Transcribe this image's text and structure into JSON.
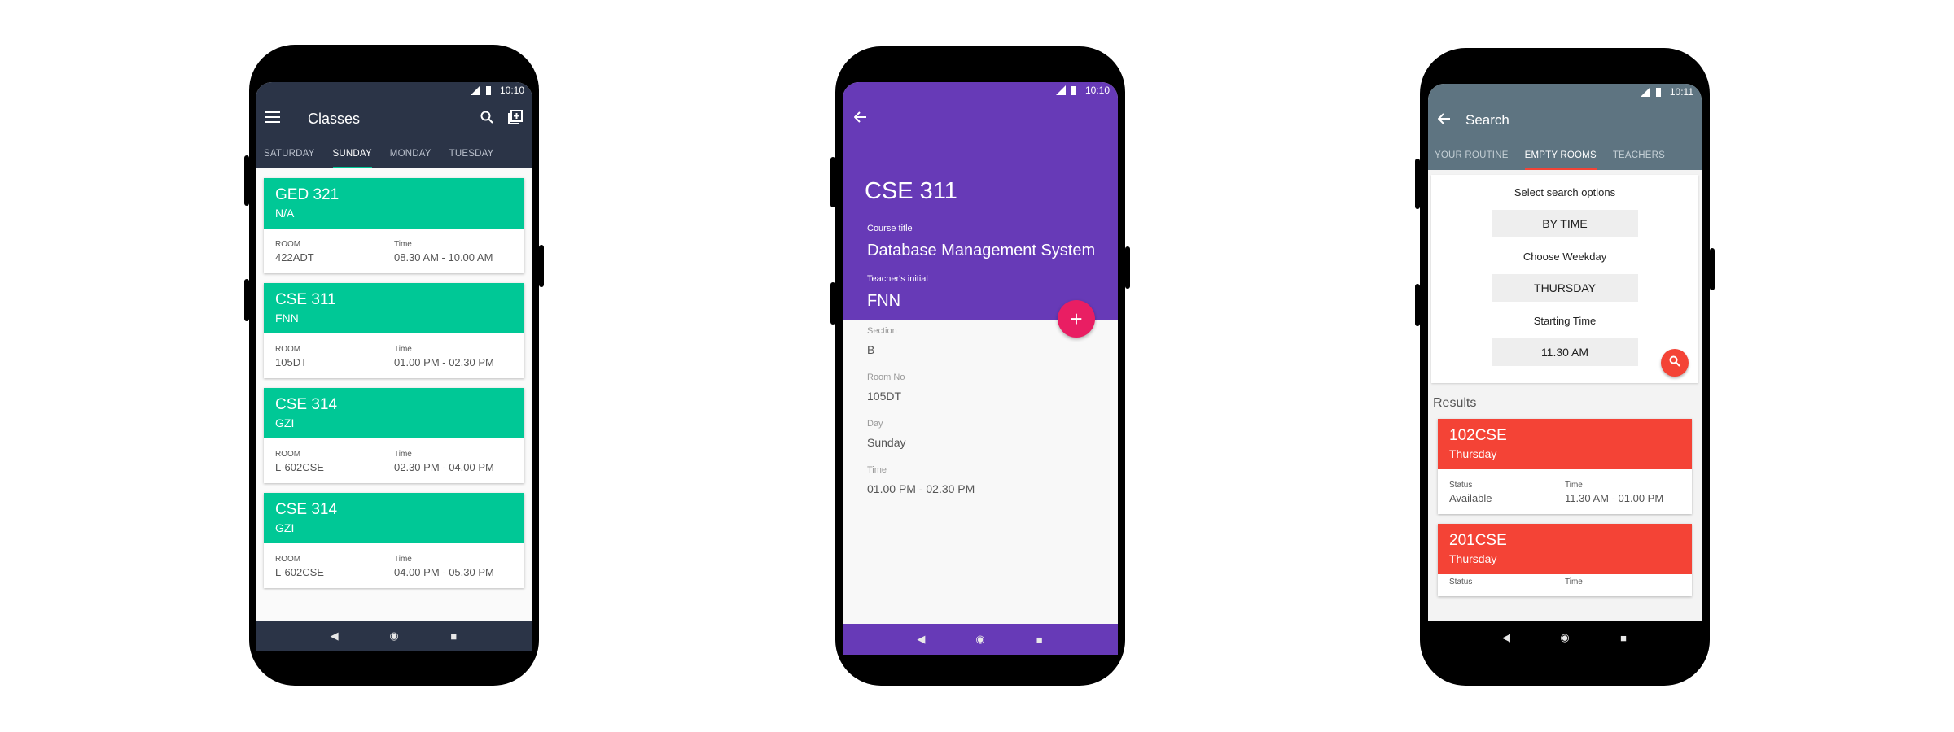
{
  "phone1": {
    "status_time": "10:10",
    "title": "Classes",
    "tabs": [
      "SATURDAY",
      "SUNDAY",
      "MONDAY",
      "TUESDAY"
    ],
    "active_tab": "SUNDAY",
    "room_label": "ROOM",
    "time_label": "Time",
    "cards": [
      {
        "course": "GED 321",
        "teacher": "N/A",
        "room": "422ADT",
        "time": "08.30 AM - 10.00 AM"
      },
      {
        "course": "CSE 311",
        "teacher": "FNN",
        "room": "105DT",
        "time": "01.00 PM - 02.30 PM"
      },
      {
        "course": "CSE 314",
        "teacher": "GZI",
        "room": "L-602CSE",
        "time": "02.30 PM - 04.00 PM"
      },
      {
        "course": "CSE 314",
        "teacher": "GZI",
        "room": "L-602CSE",
        "time": "04.00 PM - 05.30 PM"
      }
    ],
    "colors": {
      "bar": "#2b3447",
      "card_head": "#00c896"
    }
  },
  "phone2": {
    "status_time": "10:10",
    "course_code": "CSE 311",
    "course_title_label": "Course title",
    "course_title": "Database Management System",
    "teacher_label": "Teacher's initial",
    "teacher": "FNN",
    "fab_label": "+",
    "section_label": "Section",
    "section": "B",
    "room_label": "Room No",
    "room": "105DT",
    "day_label": "Day",
    "day": "Sunday",
    "time_label": "Time",
    "time": "01.00 PM - 02.30 PM",
    "colors": {
      "primary": "#673ab7",
      "fab": "#e91e63"
    }
  },
  "phone3": {
    "status_time": "10:11",
    "title": "Search",
    "tabs": [
      "YOUR ROUTINE",
      "EMPTY ROOMS",
      "TEACHERS"
    ],
    "active_tab": "EMPTY ROOMS",
    "select_label": "Select search options",
    "select_value": "BY TIME",
    "weekday_label": "Choose Weekday",
    "weekday_value": "THURSDAY",
    "start_label": "Starting Time",
    "start_value": "11.30 AM",
    "results_label": "Results",
    "status_label": "Status",
    "time_label": "Time",
    "results": [
      {
        "room": "102CSE",
        "day": "Thursday",
        "status": "Available",
        "time": "11.30 AM - 01.00 PM"
      },
      {
        "room": "201CSE",
        "day": "Thursday",
        "status": "",
        "time": ""
      }
    ],
    "colors": {
      "bar": "#5e7481",
      "card_head": "#f44336",
      "tab_indicator": "#f44336"
    }
  },
  "icons": {
    "menu": "menu-icon",
    "search": "search-icon",
    "add": "add-box-icon",
    "back": "arrow-back-icon",
    "nav_back": "◀",
    "nav_home": "◉",
    "nav_recent": "■"
  }
}
